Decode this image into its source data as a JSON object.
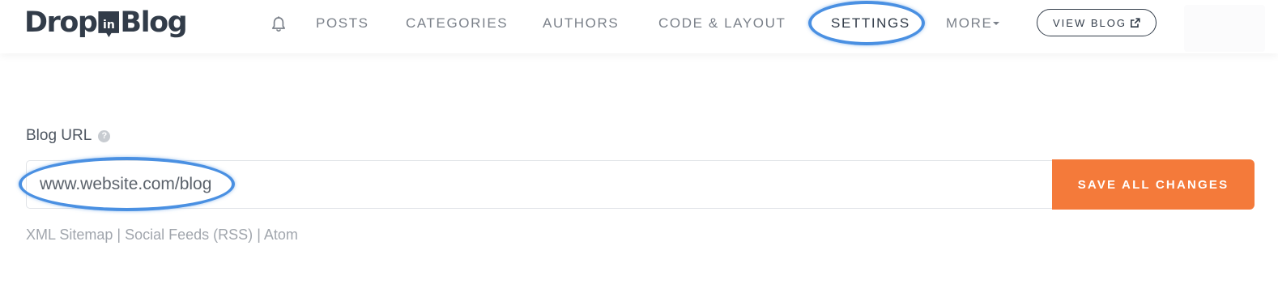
{
  "brand": {
    "pre": "Drop",
    "badge": "in",
    "post": "Blog"
  },
  "nav": {
    "notifications_icon": "bell-icon",
    "items": [
      {
        "label": "POSTS"
      },
      {
        "label": "CATEGORIES"
      },
      {
        "label": "AUTHORS"
      },
      {
        "label": "CODE & LAYOUT"
      },
      {
        "label": "SETTINGS",
        "active": true
      },
      {
        "label": "MORE"
      }
    ],
    "view_blog_label": "VIEW BLOG",
    "view_blog_icon": "external-link-icon"
  },
  "settings": {
    "blog_url_label": "Blog URL",
    "help_icon": "question-circle-icon",
    "blog_url_value": "www.website.com/blog",
    "save_label": "SAVE ALL CHANGES",
    "links": [
      "XML Sitemap",
      "Social Feeds (RSS)",
      "Atom"
    ],
    "link_separator": "|"
  },
  "colors": {
    "primary": "#323c49",
    "accent": "#f47a3a",
    "highlight_ring": "#4a90e2",
    "muted": "#7b818a"
  }
}
